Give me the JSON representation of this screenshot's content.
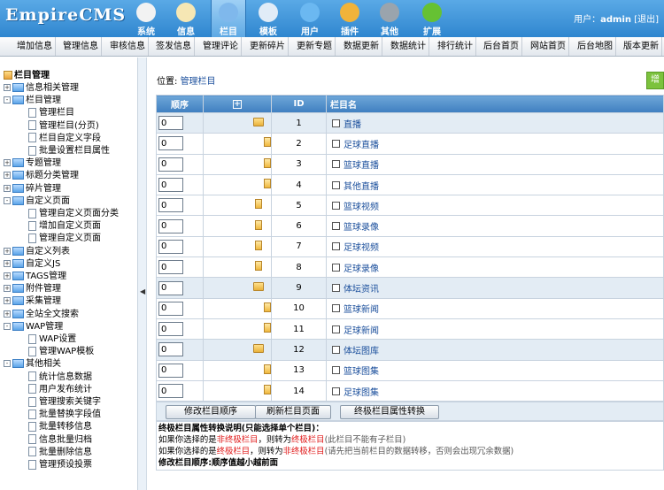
{
  "logo": {
    "text": "EmpireCMS"
  },
  "nav": [
    {
      "label": "系统",
      "icon": "globe-icon",
      "color": "#f2f2f2"
    },
    {
      "label": "信息",
      "icon": "notepad-icon",
      "color": "#f6e7b4"
    },
    {
      "label": "栏目",
      "icon": "folder-icon",
      "color": "#7fb8ec",
      "active": true
    },
    {
      "label": "模板",
      "icon": "template-icon",
      "color": "#e1ecf7"
    },
    {
      "label": "用户",
      "icon": "user-icon",
      "color": "#6bb8f1"
    },
    {
      "label": "插件",
      "icon": "tools-icon",
      "color": "#f0b33a"
    },
    {
      "label": "其他",
      "icon": "gear-icon",
      "color": "#9aa4ad"
    },
    {
      "label": "扩展",
      "icon": "plus-icon",
      "color": "#66c133"
    }
  ],
  "user": {
    "prefix": "用户：",
    "name": "admin",
    "logout": "[退出]"
  },
  "menu": [
    "增加信息",
    "管理信息",
    "审核信息",
    "签发信息",
    "管理评论",
    "更新碎片",
    "更新专题",
    "数据更新",
    "数据统计",
    "排行统计",
    "后台首页",
    "网站首页",
    "后台地图",
    "版本更新"
  ],
  "tree": {
    "root": "栏目管理",
    "items": [
      {
        "label": "信息相关管理",
        "type": "folder",
        "level": 0,
        "box": "+"
      },
      {
        "label": "栏目管理",
        "type": "folder",
        "level": 0,
        "box": "-"
      },
      {
        "label": "管理栏目",
        "type": "doc",
        "level": 1
      },
      {
        "label": "管理栏目(分页)",
        "type": "doc",
        "level": 1
      },
      {
        "label": "栏目自定义字段",
        "type": "doc",
        "level": 1
      },
      {
        "label": "批量设置栏目属性",
        "type": "doc",
        "level": 1
      },
      {
        "label": "专题管理",
        "type": "folder",
        "level": 0,
        "box": "+"
      },
      {
        "label": "标题分类管理",
        "type": "folder",
        "level": 0,
        "box": "+"
      },
      {
        "label": "碎片管理",
        "type": "folder",
        "level": 0,
        "box": "+"
      },
      {
        "label": "自定义页面",
        "type": "folder",
        "level": 0,
        "box": "-"
      },
      {
        "label": "管理自定义页面分类",
        "type": "doc",
        "level": 1
      },
      {
        "label": "增加自定义页面",
        "type": "doc",
        "level": 1
      },
      {
        "label": "管理自定义页面",
        "type": "doc",
        "level": 1
      },
      {
        "label": "自定义列表",
        "type": "folder",
        "level": 0,
        "box": "+"
      },
      {
        "label": "自定义JS",
        "type": "folder",
        "level": 0,
        "box": "+"
      },
      {
        "label": "TAGS管理",
        "type": "folder",
        "level": 0,
        "box": "+"
      },
      {
        "label": "附件管理",
        "type": "folder",
        "level": 0,
        "box": "+"
      },
      {
        "label": "采集管理",
        "type": "folder",
        "level": 0,
        "box": "+"
      },
      {
        "label": "全站全文搜索",
        "type": "folder",
        "level": 0,
        "box": "+"
      },
      {
        "label": "WAP管理",
        "type": "folder",
        "level": 0,
        "box": "-"
      },
      {
        "label": "WAP设置",
        "type": "doc",
        "level": 1
      },
      {
        "label": "管理WAP模板",
        "type": "doc",
        "level": 1
      },
      {
        "label": "其他相关",
        "type": "folder",
        "level": 0,
        "box": "-"
      },
      {
        "label": "统计信息数据",
        "type": "doc",
        "level": 1
      },
      {
        "label": "用户发布统计",
        "type": "doc",
        "level": 1
      },
      {
        "label": "管理搜索关键字",
        "type": "doc",
        "level": 1
      },
      {
        "label": "批量替换字段值",
        "type": "doc",
        "level": 1
      },
      {
        "label": "批量转移信息",
        "type": "doc",
        "level": 1
      },
      {
        "label": "信息批量归档",
        "type": "doc",
        "level": 1
      },
      {
        "label": "批量删除信息",
        "type": "doc",
        "level": 1
      },
      {
        "label": "管理预设投票",
        "type": "doc",
        "level": 1
      }
    ]
  },
  "location": {
    "prefix": "位置:",
    "link": "管理栏目"
  },
  "add_button": "增",
  "table": {
    "headers": {
      "order": "顺序",
      "expand": "+",
      "id": "ID",
      "name": "栏目名"
    },
    "rows": [
      {
        "order": "0",
        "id": "1",
        "name": "直播",
        "kind": "folder"
      },
      {
        "order": "0",
        "id": "2",
        "name": "足球直播",
        "kind": "doc"
      },
      {
        "order": "0",
        "id": "3",
        "name": "篮球直播",
        "kind": "doc"
      },
      {
        "order": "0",
        "id": "4",
        "name": "其他直播",
        "kind": "doc"
      },
      {
        "order": "0",
        "id": "5",
        "name": "篮球视频",
        "kind": "doc2"
      },
      {
        "order": "0",
        "id": "6",
        "name": "篮球录像",
        "kind": "doc2"
      },
      {
        "order": "0",
        "id": "7",
        "name": "足球视频",
        "kind": "doc2"
      },
      {
        "order": "0",
        "id": "8",
        "name": "足球录像",
        "kind": "doc2"
      },
      {
        "order": "0",
        "id": "9",
        "name": "体坛资讯",
        "kind": "folder"
      },
      {
        "order": "0",
        "id": "10",
        "name": "篮球新闻",
        "kind": "doc"
      },
      {
        "order": "0",
        "id": "11",
        "name": "足球新闻",
        "kind": "doc"
      },
      {
        "order": "0",
        "id": "12",
        "name": "体坛图库",
        "kind": "folder"
      },
      {
        "order": "0",
        "id": "13",
        "name": "篮球图集",
        "kind": "doc"
      },
      {
        "order": "0",
        "id": "14",
        "name": "足球图集",
        "kind": "doc"
      }
    ]
  },
  "buttons": {
    "edit_order": "修改栏目顺序",
    "refresh": "刷新栏目页面",
    "convert": "终极栏目属性转换"
  },
  "notes": {
    "title": "终极栏目属性转换说明(只能选择单个栏目)：",
    "l1a": "如果你选择的是",
    "l1b": "非终极栏目",
    "l1c": "，则转为",
    "l1d": "终极栏目",
    "l1e": "(此栏目不能有子栏目)",
    "l2a": "如果你选择的是",
    "l2b": "终极栏目",
    "l2c": "，则转为",
    "l2d": "非终极栏目",
    "l2e": "(请先把当前栏目的数据转移，否则会出现冗余数据)",
    "l3": "修改栏目顺序:顺序值越小越前面"
  }
}
